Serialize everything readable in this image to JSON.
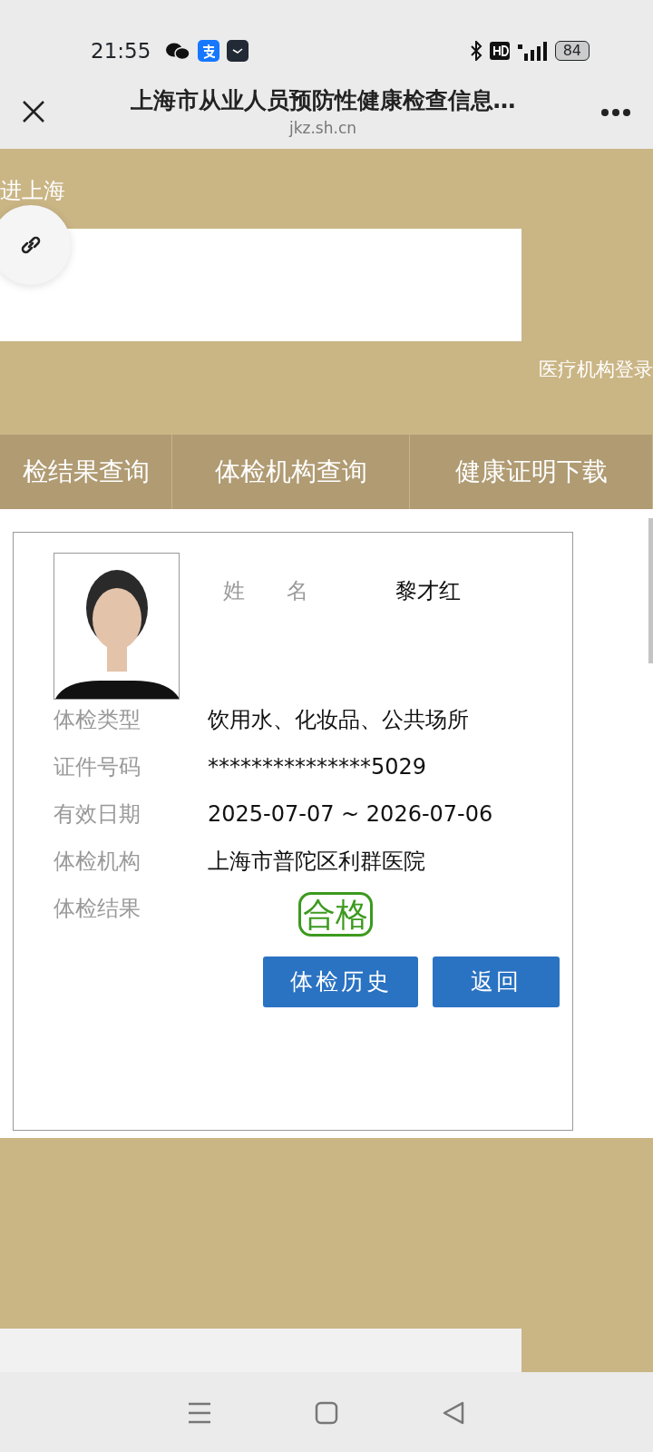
{
  "status_bar": {
    "time": "21:55",
    "battery": "84"
  },
  "title_bar": {
    "title": "上海市从业人员预防性健康检查信息…",
    "url": "jkz.sh.cn"
  },
  "banner": {
    "text": "进上海",
    "login_link": "医疗机构登录"
  },
  "tabs": [
    {
      "label": "检结果查询",
      "selected": false
    },
    {
      "label": "体检机构查询",
      "selected": false
    },
    {
      "label": "健康证明下载",
      "selected": false
    }
  ],
  "record": {
    "photo": {
      "kind": "picture"
    },
    "name_label": [
      "姓",
      "名"
    ],
    "name": "黎才红",
    "fields": [
      {
        "label": "体检类型",
        "value": "饮用水、化妆品、公共场所"
      },
      {
        "label": "证件号码",
        "value": "***************5029"
      },
      {
        "label": "有效日期",
        "value": "2025-07-07 ~ 2026-07-06"
      },
      {
        "label": "体检机构",
        "value": "上海市普陀区利群医院"
      },
      {
        "label": "体检结果",
        "value": "合格",
        "kind": "stamp"
      }
    ],
    "buttons": [
      "体检历史",
      "返回"
    ]
  }
}
